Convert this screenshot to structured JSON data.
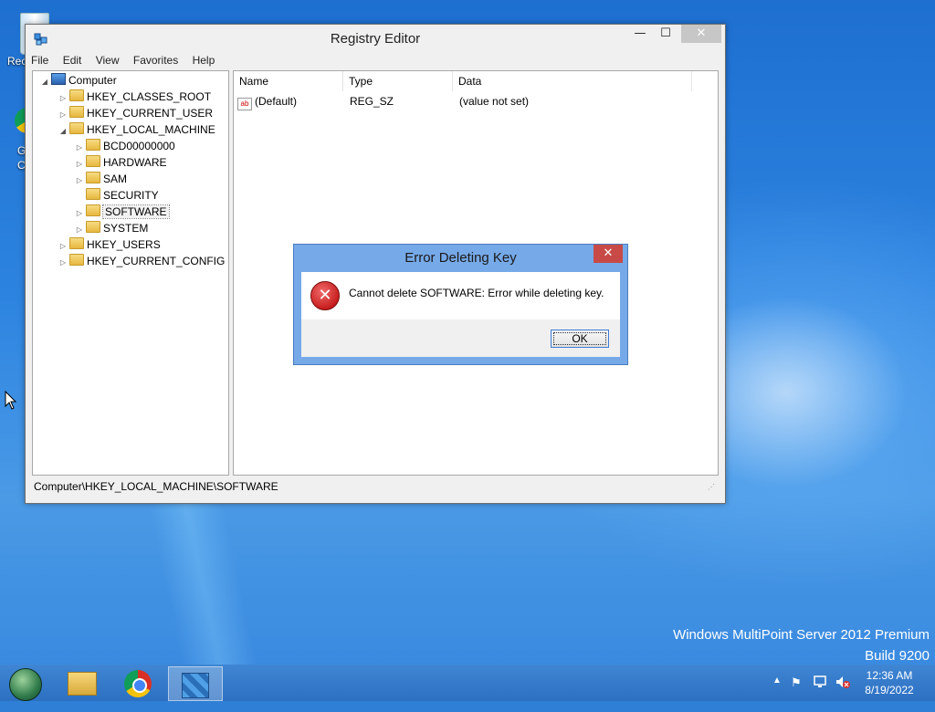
{
  "desktop": {
    "recycle_label": "Rec",
    "chrome_label_line1": "G",
    "chrome_label_line2": "C",
    "watermark_line1": "Windows MultiPoint Server 2012 Premium",
    "watermark_line2": "Build 9200"
  },
  "window": {
    "title": "Registry Editor",
    "minimize_glyph": "—",
    "maximize_glyph": "☐",
    "close_glyph": "✕",
    "menu": [
      "File",
      "Edit",
      "View",
      "Favorites",
      "Help"
    ],
    "tree": {
      "root": "Computer",
      "hives": [
        {
          "label": "HKEY_CLASSES_ROOT",
          "expander": "▷"
        },
        {
          "label": "HKEY_CURRENT_USER",
          "expander": "▷"
        },
        {
          "label": "HKEY_LOCAL_MACHINE",
          "expander": "◢"
        },
        {
          "label": "HKEY_USERS",
          "expander": "▷"
        },
        {
          "label": "HKEY_CURRENT_CONFIG",
          "expander": "▷"
        }
      ],
      "hklm_children": [
        {
          "label": "BCD00000000",
          "expander": "▷"
        },
        {
          "label": "HARDWARE",
          "expander": "▷"
        },
        {
          "label": "SAM",
          "expander": "▷"
        },
        {
          "label": "SECURITY",
          "expander": ""
        },
        {
          "label": "SOFTWARE",
          "expander": "▷",
          "selected": true
        },
        {
          "label": "SYSTEM",
          "expander": "▷"
        }
      ]
    },
    "columns": {
      "name": "Name",
      "type": "Type",
      "data": "Data"
    },
    "values": [
      {
        "icon": "ab",
        "name": "(Default)",
        "type": "REG_SZ",
        "data": "(value not set)"
      }
    ],
    "status_path": "Computer\\HKEY_LOCAL_MACHINE\\SOFTWARE"
  },
  "dialog": {
    "title": "Error Deleting Key",
    "close_glyph": "✕",
    "message": "Cannot delete SOFTWARE:  Error while deleting key.",
    "ok_label": "OK",
    "icon": "error-icon"
  },
  "taskbar": {
    "tray_up": "▲",
    "clock_time": "12:36 AM",
    "clock_date": "8/19/2022"
  },
  "colors": {
    "dialog_border": "#76a9e8",
    "taskbar": "#2d70c2",
    "close_red": "#c74a47"
  }
}
